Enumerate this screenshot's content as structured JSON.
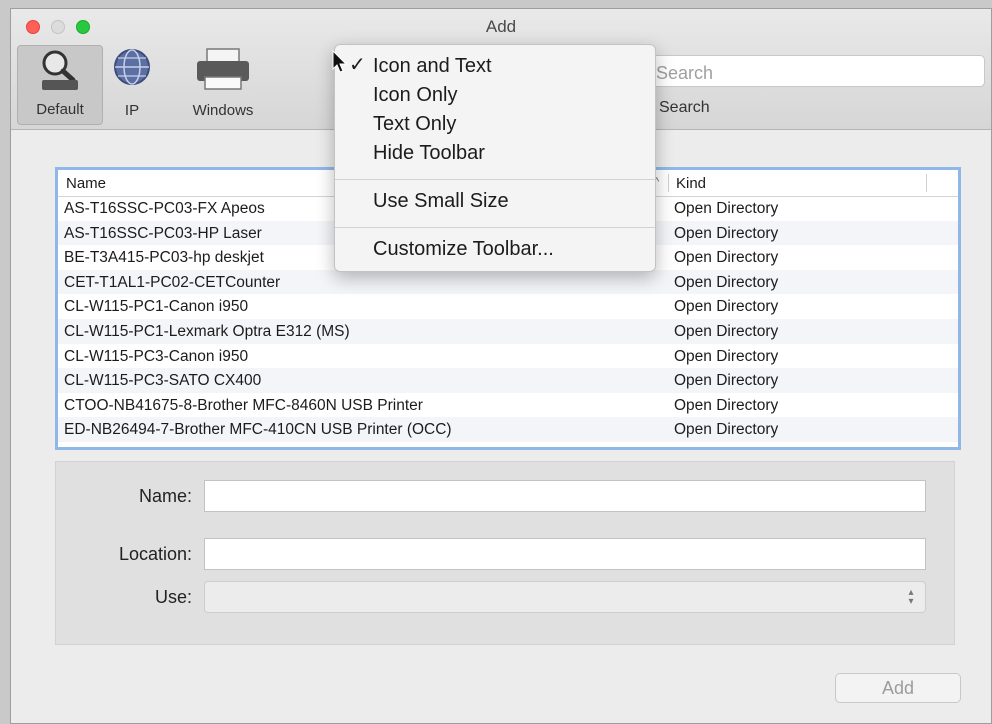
{
  "window": {
    "title": "Add"
  },
  "toolbar": {
    "items": [
      {
        "label": "Default",
        "icon": "magnifier-icon",
        "selected": true
      },
      {
        "label": "IP",
        "icon": "globe-icon",
        "selected": false
      },
      {
        "label": "Windows",
        "icon": "printer-icon",
        "selected": false
      }
    ],
    "search_placeholder": "Search",
    "search_label": "Search"
  },
  "context_menu": {
    "items": [
      {
        "label": "Icon and Text",
        "checked": true
      },
      {
        "label": "Icon Only",
        "checked": false
      },
      {
        "label": "Text Only",
        "checked": false
      },
      {
        "label": "Hide Toolbar",
        "checked": false
      },
      {
        "label": "Use Small Size",
        "checked": false
      },
      {
        "label": "Customize Toolbar...",
        "checked": false
      }
    ],
    "check_glyph": "✓"
  },
  "printer_list": {
    "columns": {
      "name": "Name",
      "kind": "Kind"
    },
    "rows": [
      {
        "name": "AS-T16SSC-PC03-FX Apeos",
        "kind": "Open Directory"
      },
      {
        "name": "AS-T16SSC-PC03-HP Laser",
        "kind": "Open Directory"
      },
      {
        "name": "BE-T3A415-PC03-hp deskjet",
        "kind": "Open Directory"
      },
      {
        "name": "CET-T1AL1-PC02-CETCounter",
        "kind": "Open Directory"
      },
      {
        "name": "CL-W115-PC1-Canon i950",
        "kind": "Open Directory"
      },
      {
        "name": "CL-W115-PC1-Lexmark Optra E312 (MS)",
        "kind": "Open Directory"
      },
      {
        "name": "CL-W115-PC3-Canon i950",
        "kind": "Open Directory"
      },
      {
        "name": "CL-W115-PC3-SATO CX400",
        "kind": "Open Directory"
      },
      {
        "name": "CTOO-NB41675-8-Brother MFC-8460N USB Printer",
        "kind": "Open Directory"
      },
      {
        "name": "ED-NB26494-7-Brother MFC-410CN USB Printer (OCC)",
        "kind": "Open Directory"
      }
    ]
  },
  "form": {
    "name_label": "Name:",
    "name_value": "",
    "location_label": "Location:",
    "location_value": "",
    "use_label": "Use:",
    "use_value": ""
  },
  "buttons": {
    "add": "Add"
  },
  "colors": {
    "accent": "#8fb8e8",
    "close": "#ff5f57",
    "zoom": "#28c840"
  }
}
